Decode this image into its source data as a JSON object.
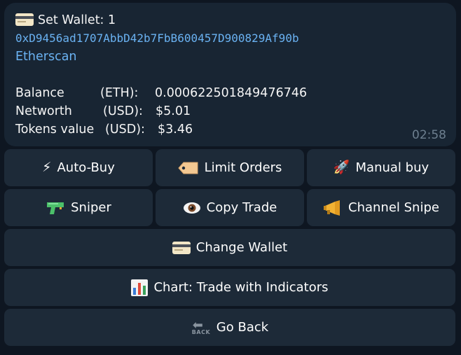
{
  "message": {
    "title": "Set Wallet: 1",
    "address": "0xD9456ad1707AbbD42b7FbB600457D900829Af90b",
    "explorer_link": "Etherscan",
    "rows": [
      {
        "label": "Balance",
        "unit": "(ETH):",
        "value": "0.000622501849476746"
      },
      {
        "label": "Networth",
        "unit": "(USD):",
        "value": "$5.01"
      },
      {
        "label": "Tokens value",
        "unit": "(USD):",
        "value": "$3.46"
      }
    ],
    "time": "02:58",
    "icons": {
      "title": "credit-card-icon"
    }
  },
  "keyboard": {
    "auto_buy": "Auto-Buy",
    "limit_orders": "Limit Orders",
    "manual_buy": "Manual buy",
    "sniper": "Sniper",
    "copy_trade": "Copy Trade",
    "channel_snipe": "Channel Snipe",
    "change_wallet": "Change Wallet",
    "chart": "Chart: Trade with Indicators",
    "go_back": "Go Back",
    "icons": {
      "auto_buy": "lightning-icon",
      "limit_orders": "label-tag-icon",
      "manual_buy": "rocket-icon",
      "sniper": "water-pistol-icon",
      "copy_trade": "eye-icon",
      "channel_snipe": "megaphone-icon",
      "change_wallet": "credit-card-icon",
      "chart": "bar-chart-icon",
      "go_back": "back-arrow-icon"
    },
    "back_icon_text": "BACK"
  },
  "colors": {
    "background": "#0e1621",
    "message_bg": "#182533",
    "button_bg": "#1d2a38",
    "link": "#6ab2f2",
    "time": "#6d7f8f"
  }
}
